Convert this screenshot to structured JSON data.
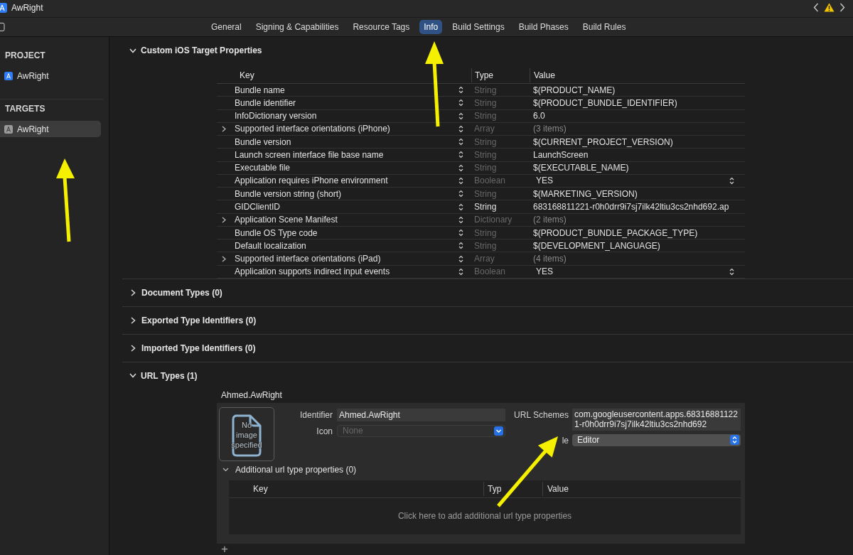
{
  "window": {
    "title": "AwRight"
  },
  "tabs": [
    {
      "label": "General",
      "selected": false
    },
    {
      "label": "Signing & Capabilities",
      "selected": false
    },
    {
      "label": "Resource Tags",
      "selected": false
    },
    {
      "label": "Info",
      "selected": true
    },
    {
      "label": "Build Settings",
      "selected": false
    },
    {
      "label": "Build Phases",
      "selected": false
    },
    {
      "label": "Build Rules",
      "selected": false
    }
  ],
  "sidebar": {
    "sections": [
      {
        "title": "PROJECT",
        "items": [
          {
            "label": "AwRight",
            "kind": "project",
            "selected": false
          }
        ]
      },
      {
        "title": "TARGETS",
        "items": [
          {
            "label": "AwRight",
            "kind": "target",
            "selected": true
          }
        ]
      }
    ]
  },
  "sections": [
    {
      "title": "Custom iOS Target Properties",
      "expanded": true,
      "table": {
        "columns": [
          "Key",
          "Type",
          "Value"
        ],
        "rows": [
          {
            "key": "Bundle name",
            "type": "String",
            "value": "$(PRODUCT_NAME)",
            "kind": "text",
            "dimmed": true
          },
          {
            "key": "Bundle identifier",
            "type": "String",
            "value": "$(PRODUCT_BUNDLE_IDENTIFIER)",
            "kind": "text",
            "dimmed": true
          },
          {
            "key": "InfoDictionary version",
            "type": "String",
            "value": "6.0",
            "kind": "text",
            "dimmed": true
          },
          {
            "key": "Supported interface orientations (iPhone)",
            "type": "Array",
            "value": "(3 items)",
            "kind": "collection",
            "dimmed": true
          },
          {
            "key": "Bundle version",
            "type": "String",
            "value": "$(CURRENT_PROJECT_VERSION)",
            "kind": "text",
            "dimmed": true
          },
          {
            "key": "Launch screen interface file base name",
            "type": "String",
            "value": "LaunchScreen",
            "kind": "text",
            "dimmed": true
          },
          {
            "key": "Executable file",
            "type": "String",
            "value": "$(EXECUTABLE_NAME)",
            "kind": "text",
            "dimmed": true
          },
          {
            "key": "Application requires iPhone environment",
            "type": "Boolean",
            "value": "YES",
            "kind": "boolean",
            "dimmed": true
          },
          {
            "key": "Bundle version string (short)",
            "type": "String",
            "value": "$(MARKETING_VERSION)",
            "kind": "text",
            "dimmed": true
          },
          {
            "key": "GIDClientID",
            "type": "String",
            "value": "683168811221-r0h0drr9i7sj7ilk42ltiu3cs2nhd692.ap",
            "kind": "text",
            "dimmed": false
          },
          {
            "key": "Application Scene Manifest",
            "type": "Dictionary",
            "value": "(2 items)",
            "kind": "collection",
            "dimmed": true
          },
          {
            "key": "Bundle OS Type code",
            "type": "String",
            "value": "$(PRODUCT_BUNDLE_PACKAGE_TYPE)",
            "kind": "text",
            "dimmed": true
          },
          {
            "key": "Default localization",
            "type": "String",
            "value": "$(DEVELOPMENT_LANGUAGE)",
            "kind": "text",
            "dimmed": true
          },
          {
            "key": "Supported interface orientations (iPad)",
            "type": "Array",
            "value": "(4 items)",
            "kind": "collection",
            "dimmed": true
          },
          {
            "key": "Application supports indirect input events",
            "type": "Boolean",
            "value": "YES",
            "kind": "boolean",
            "dimmed": true
          }
        ]
      }
    },
    {
      "title": "Document Types (0)",
      "expanded": false
    },
    {
      "title": "Exported Type Identifiers (0)",
      "expanded": false
    },
    {
      "title": "Imported Type Identifiers (0)",
      "expanded": false
    },
    {
      "title": "URL Types (1)",
      "expanded": true,
      "url_types": [
        {
          "name": "Ahmed.AwRight",
          "image_text": "No image specified",
          "identifier": {
            "label": "Identifier",
            "value": "Ahmed.AwRight"
          },
          "icon": {
            "label": "Icon",
            "value": "None",
            "disabled": true
          },
          "url_schemes": {
            "label": "URL Schemes",
            "value": "com.googleusercontent.apps.683168811221-r0h0drr9i7sj7ilk42ltiu3cs2nhd692"
          },
          "role": {
            "label": "le",
            "value": "Editor"
          },
          "additional": {
            "title": "Additional url type properties (0)",
            "expanded": true,
            "columns": [
              "Key",
              "Typ",
              "Value"
            ],
            "empty_text": "Click here to add additional url type properties"
          }
        }
      ],
      "add_button": "+"
    }
  ]
}
